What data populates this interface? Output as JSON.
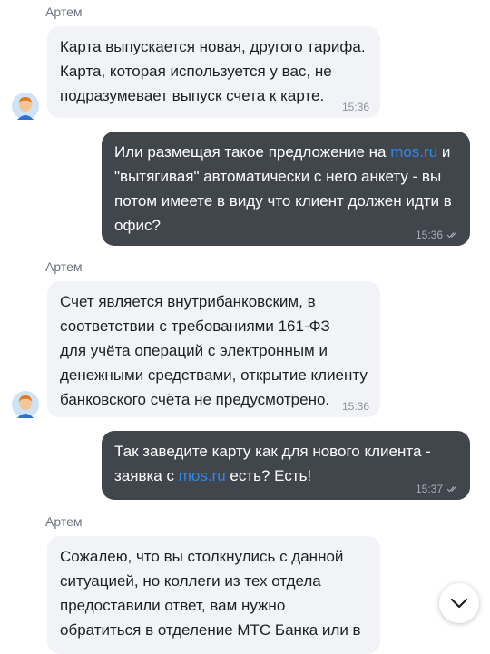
{
  "messages": [
    {
      "sender": "Артем",
      "text_lines": [
        "Карта выпускается новая, другого тарифа.",
        "Карта, которая используется у вас, не",
        "подразумевает выпуск счета к карте."
      ],
      "time": "15:36"
    },
    {
      "line1_before": "Или размещая такое предложение на ",
      "line1_link": "mos.ru",
      "line1_after": " и",
      "lines_rest": [
        "\"вытягивая\" автоматически с него анкету - вы",
        "потом имеете в виду что клиент должен идти в",
        "офис?"
      ],
      "time": "15:36"
    },
    {
      "sender": "Артем",
      "text_lines": [
        "Счет является внутрибанковским, в",
        "соответствии с требованиями 161-ФЗ",
        "для учёта операций с электронным и",
        "денежными средствами, открытие клиенту",
        "банковского счёта не предусмотрено."
      ],
      "time": "15:36"
    },
    {
      "line1": "Так заведите карту как для нового клиента -",
      "line2_before": "заявка с ",
      "line2_link": "mos.ru",
      "line2_after": " есть? Есть!",
      "time": "15:37"
    },
    {
      "sender": "Артем",
      "text_lines": [
        "Сожалею, что вы столкнулись с данной",
        "ситуацией, но коллеги из тех отдела",
        "предоставили ответ, вам нужно",
        "обратиться в отделение МТС Банка или в"
      ]
    }
  ],
  "icons": {
    "avatar": "avatar-icon",
    "read_receipt": "double-check-icon",
    "scroll_down": "chevron-down-icon"
  },
  "colors": {
    "incoming_bubble": "#f2f3f7",
    "outgoing_bubble": "#41464d",
    "link": "#2f87f0"
  }
}
